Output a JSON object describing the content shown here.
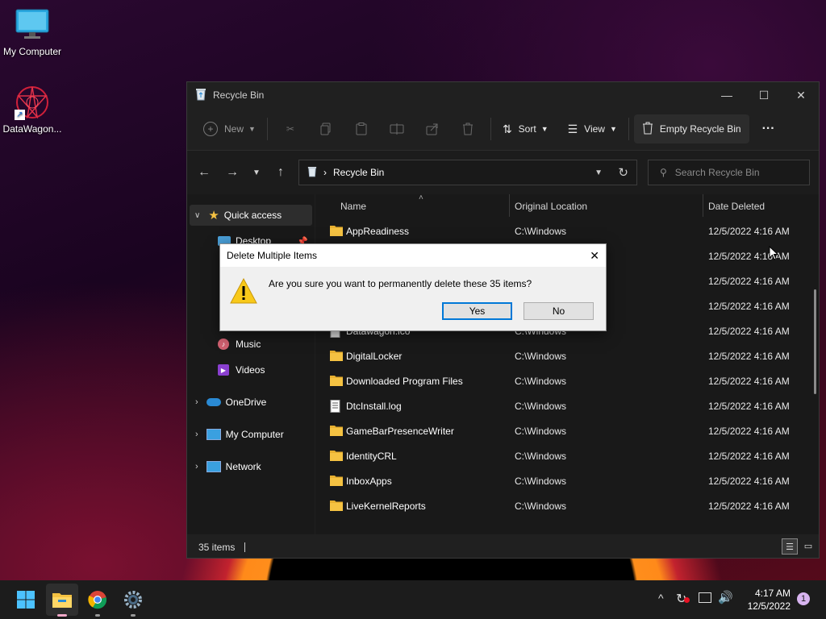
{
  "desktop": {
    "icons": [
      {
        "label": "My Computer",
        "icon": "monitor-icon"
      },
      {
        "label": "DataWagon...",
        "icon": "datawagon-shortcut-icon"
      }
    ]
  },
  "window": {
    "title": "Recycle Bin",
    "controls": {
      "minimize": "—",
      "maximize": "☐",
      "close": "✕"
    },
    "toolbar": {
      "new_label": "New",
      "sort_label": "Sort",
      "view_label": "View",
      "empty_label": "Empty Recycle Bin",
      "more_label": "···"
    },
    "address": {
      "path": "Recycle Bin",
      "search_placeholder": "Search Recycle Bin"
    },
    "sidebar": {
      "items": [
        {
          "label": "Quick access",
          "icon": "star-icon"
        },
        {
          "label": "Desktop",
          "icon": "desktop-folder-icon"
        },
        {
          "label": "Music",
          "icon": "music-icon"
        },
        {
          "label": "Videos",
          "icon": "videos-icon"
        },
        {
          "label": "OneDrive",
          "icon": "cloud-icon"
        },
        {
          "label": "My Computer",
          "icon": "monitor-icon"
        },
        {
          "label": "Network",
          "icon": "network-icon"
        }
      ]
    },
    "columns": {
      "name": "Name",
      "location": "Original Location",
      "date": "Date Deleted"
    },
    "files": [
      {
        "name": "AppReadiness",
        "location": "C:\\Windows",
        "date": "12/5/2022 4:16 AM",
        "icon": "folder-icon"
      },
      {
        "name": "",
        "location": "",
        "date": "12/5/2022 4:16 AM",
        "icon": "folder-icon"
      },
      {
        "name": "",
        "location": "",
        "date": "12/5/2022 4:16 AM",
        "icon": "folder-icon"
      },
      {
        "name": "",
        "location": "",
        "date": "12/5/2022 4:16 AM",
        "icon": "folder-icon"
      },
      {
        "name": "Datawagon.ico",
        "location": "C:\\Windows",
        "date": "12/5/2022 4:16 AM",
        "icon": "file-icon"
      },
      {
        "name": "DigitalLocker",
        "location": "C:\\Windows",
        "date": "12/5/2022 4:16 AM",
        "icon": "folder-icon"
      },
      {
        "name": "Downloaded Program Files",
        "location": "C:\\Windows",
        "date": "12/5/2022 4:16 AM",
        "icon": "folder-icon"
      },
      {
        "name": "DtcInstall.log",
        "location": "C:\\Windows",
        "date": "12/5/2022 4:16 AM",
        "icon": "text-file-icon"
      },
      {
        "name": "GameBarPresenceWriter",
        "location": "C:\\Windows",
        "date": "12/5/2022 4:16 AM",
        "icon": "folder-icon"
      },
      {
        "name": "IdentityCRL",
        "location": "C:\\Windows",
        "date": "12/5/2022 4:16 AM",
        "icon": "folder-icon"
      },
      {
        "name": "InboxApps",
        "location": "C:\\Windows",
        "date": "12/5/2022 4:16 AM",
        "icon": "folder-icon"
      },
      {
        "name": "LiveKernelReports",
        "location": "C:\\Windows",
        "date": "12/5/2022 4:16 AM",
        "icon": "folder-icon"
      }
    ],
    "status": {
      "count": "35 items"
    }
  },
  "dialog": {
    "title": "Delete Multiple Items",
    "message": "Are you sure you want to permanently delete these 35 items?",
    "yes_label": "Yes",
    "no_label": "No",
    "close_label": "✕"
  },
  "taskbar": {
    "time": "4:17 AM",
    "date": "12/5/2022",
    "notification_count": "1",
    "apps": [
      {
        "icon": "windows-start-icon"
      },
      {
        "icon": "file-explorer-icon"
      },
      {
        "icon": "chrome-icon"
      },
      {
        "icon": "settings-icon"
      }
    ]
  },
  "colors": {
    "accent": "#0078d7",
    "folder": "#f5c242",
    "window_bg": "#191919"
  }
}
